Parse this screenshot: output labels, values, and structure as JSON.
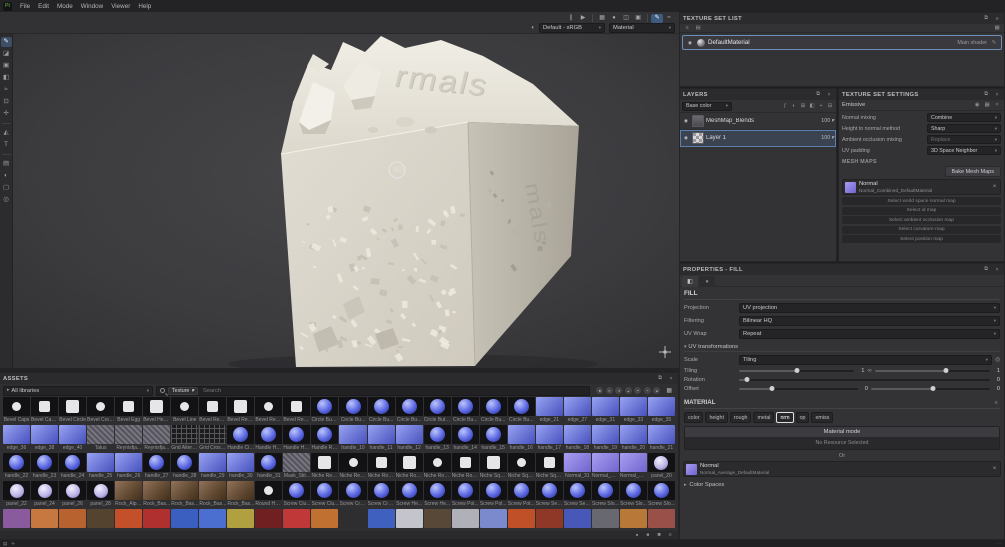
{
  "app": {
    "logo": "Pt"
  },
  "menubar": {
    "items": [
      "File",
      "Edit",
      "Mode",
      "Window",
      "Viewer",
      "Help"
    ]
  },
  "toolbar": {
    "icon_groups": [
      [
        "pause-icon",
        "play-icon"
      ],
      [
        "wireframe-icon",
        "material-ball-icon",
        "split-view-icon",
        "camera-icon"
      ],
      [
        "pencil-icon",
        "lazy-mouse-icon"
      ]
    ],
    "active_icon": "pencil-icon",
    "color_profile": "Default - sRGB",
    "shader": "Material"
  },
  "left_toolbar": {
    "groups": [
      [
        "paint-brush-icon",
        "eraser-icon",
        "projection-icon",
        "polygon-fill-icon",
        "smudge-icon",
        "clone-icon",
        "material-picker-icon"
      ],
      [
        "geometry-mask-icon",
        "text-tool-icon"
      ],
      [
        "shelf-icon",
        "display-settings-icon",
        "camera-settings-icon",
        "environment-icon"
      ]
    ]
  },
  "viewport": {
    "mesh_text": "rmals",
    "mesh_side_text": "mals"
  },
  "texture_set_list": {
    "title": "TEXTURE SET LIST",
    "material_name": "DefaultMaterial",
    "shader_label": "Main shader"
  },
  "layers": {
    "title": "LAYERS",
    "channel_filter": "Base color",
    "toolbar_icons": [
      "add-effect-icon",
      "add-mask-icon",
      "add-folder-icon",
      "add-fill-layer-icon",
      "add-paint-layer-icon",
      "delete-layer-icon"
    ],
    "rows": [
      {
        "name": "MeshMap_Blends",
        "type": "folder",
        "opacity": "100",
        "selected": false
      },
      {
        "name": "Layer 1",
        "type": "fill",
        "opacity": "100",
        "selected": true
      }
    ]
  },
  "texture_set_settings": {
    "title": "TEXTURE SET SETTINGS",
    "channel_label": "Emissive",
    "rows": [
      {
        "label": "Normal mixing",
        "value": "Combine",
        "disabled": false
      },
      {
        "label": "Height to normal method",
        "value": "Sharp",
        "disabled": false
      },
      {
        "label": "Ambient occlusion mixing",
        "value": "Replace",
        "disabled": true
      },
      {
        "label": "UV padding",
        "value": "3D Space Neighbor",
        "disabled": false
      }
    ],
    "mesh_maps_title": "MESH MAPS",
    "bake_button": "Bake Mesh Maps",
    "baked_map": {
      "type": "Normal",
      "resource": "Normal_Combined_DefaultMaterial"
    },
    "empty_maps": [
      "Select world space normal map",
      "Select id map",
      "Select ambient occlusion map",
      "Select curvature map",
      "Select position map"
    ]
  },
  "properties": {
    "title": "PROPERTIES - FILL",
    "fill_section": "FILL",
    "rows": [
      {
        "label": "Projection",
        "value": "UV projection"
      },
      {
        "label": "Filtering",
        "value": "Bilinear HQ"
      },
      {
        "label": "UV Wrap",
        "value": "Repeat"
      }
    ],
    "uv_section": "UV transformations",
    "scale_label": "Scale",
    "scale_mode": "Tiling",
    "tiling_label": "Tiling",
    "tiling_u": "1",
    "tiling_v": "1",
    "rotation_label": "Rotation",
    "rotation_value": "0",
    "offset_label": "Offset",
    "offset_u": "0",
    "offset_v": "0",
    "material_section": "MATERIAL",
    "channels": [
      "color",
      "height",
      "rough",
      "metal",
      "nrm",
      "op",
      "emiss"
    ],
    "active_channel": "nrm",
    "material_mode_title": "Material mode",
    "material_mode_hint": "No Resource Selected",
    "or_label": "Or",
    "normal_map": {
      "type": "Normal",
      "resource": "Normal_Average_DefaultMaterial"
    },
    "color_spaces": "Color Spaces"
  },
  "assets": {
    "title": "ASSETS",
    "libraries": "All libraries",
    "type_filter": "Texture",
    "search_placeholder": "Search",
    "filter_icons": [
      "filter-all-icon",
      "filter-materials-icon",
      "filter-smart-materials-icon",
      "filter-smart-masks-icon",
      "filter-filters-icon",
      "filter-brushes-icon",
      "filter-alphas-icon"
    ],
    "grid": [
      [
        [
          "Bevel Caps",
          "b"
        ],
        [
          "Bevel Cap...",
          "b"
        ],
        [
          "Bevel Circle",
          "b"
        ],
        [
          "Bevel Cros...",
          "b"
        ],
        [
          "Bevel Egg",
          "b"
        ],
        [
          "Bevel Hea...",
          "b"
        ],
        [
          "Bevel Line",
          "b"
        ],
        [
          "Bevel Rect...",
          "b"
        ],
        [
          "Bevel Rect...",
          "b"
        ],
        [
          "Bevel Rect...",
          "b"
        ],
        [
          "Bevel Rect...",
          "b"
        ],
        [
          "Circle Bump",
          "s"
        ],
        [
          "Circle Bu...",
          "s"
        ],
        [
          "Circle Bu...",
          "s"
        ],
        [
          "Circle Bu...",
          "s"
        ],
        [
          "Circle Button",
          "s"
        ],
        [
          "Circle Bu...",
          "s"
        ],
        [
          "Circle Bu...",
          "s"
        ],
        [
          "Circle Bu...",
          "s"
        ],
        [
          "edge_21",
          "q"
        ],
        [
          "edge_27",
          "q"
        ],
        [
          "edge_31",
          "q"
        ],
        [
          "edge_33",
          "q"
        ],
        [
          "edge_35",
          "q"
        ]
      ],
      [
        [
          "edge_36",
          "q"
        ],
        [
          "edge_38",
          "q"
        ],
        [
          "edge_40",
          "q"
        ],
        [
          "Talus",
          "t"
        ],
        [
          "Reynisfja...",
          "t"
        ],
        [
          "Reynisfja...",
          "t"
        ],
        [
          "Grid Altern...",
          "g"
        ],
        [
          "Grid Crossed",
          "g"
        ],
        [
          "Handle Cir...",
          "s"
        ],
        [
          "Handle Ha...",
          "s"
        ],
        [
          "Handle Ha...",
          "s"
        ],
        [
          "Handle Ro...",
          "s"
        ],
        [
          "handle_10",
          "q"
        ],
        [
          "handle_11",
          "q"
        ],
        [
          "handle_12",
          "q"
        ],
        [
          "handle_13",
          "s"
        ],
        [
          "handle_14",
          "s"
        ],
        [
          "handle_15",
          "s"
        ],
        [
          "handle_16",
          "q"
        ],
        [
          "handle_17",
          "q"
        ],
        [
          "handle_18",
          "q"
        ],
        [
          "handle_19",
          "q"
        ],
        [
          "handle_20",
          "q"
        ],
        [
          "handle_21",
          "q"
        ]
      ],
      [
        [
          "handle_22",
          "s"
        ],
        [
          "handle_23",
          "s"
        ],
        [
          "handle_24",
          "s"
        ],
        [
          "handle_25",
          "q"
        ],
        [
          "handle_26",
          "q"
        ],
        [
          "handle_27",
          "s"
        ],
        [
          "handle_28",
          "s"
        ],
        [
          "handle_29",
          "q"
        ],
        [
          "handle_30",
          "q"
        ],
        [
          "handle_31",
          "s"
        ],
        [
          "Mask_Stit...",
          "t"
        ],
        [
          "Niche Rect...",
          "b"
        ],
        [
          "Niche Rect...",
          "b"
        ],
        [
          "Niche Rou...",
          "b"
        ],
        [
          "Niche Rou...",
          "b"
        ],
        [
          "Niche Rou...",
          "b"
        ],
        [
          "Niche Rou...",
          "b"
        ],
        [
          "Niche Squ...",
          "b"
        ],
        [
          "Niche Squ...",
          "b"
        ],
        [
          "Niche Squ...",
          "b"
        ],
        [
          "Normal_31",
          "n"
        ],
        [
          "Normal_Av...",
          "n"
        ],
        [
          "Normal_Co...",
          "n"
        ],
        [
          "panel_20",
          "w"
        ]
      ],
      [
        [
          "panel_22",
          "w"
        ],
        [
          "panel_24",
          "w"
        ],
        [
          "panel_26",
          "w"
        ],
        [
          "panel_28",
          "w"
        ],
        [
          "Rock_Alph...",
          "r"
        ],
        [
          "Rock_Bas...",
          "r"
        ],
        [
          "Rock_Bas...",
          "r"
        ],
        [
          "Rock_Bas...",
          "r"
        ],
        [
          "Rock_Bas...",
          "r"
        ],
        [
          "Round Hol...",
          "b"
        ],
        [
          "Screw Clu...",
          "s"
        ],
        [
          "Screw Clu...",
          "s"
        ],
        [
          "Screw Cro...",
          "s"
        ],
        [
          "Screw Cro...",
          "s"
        ],
        [
          "Screw He...",
          "s"
        ],
        [
          "Screw He...",
          "s"
        ],
        [
          "Screw Pol...",
          "s"
        ],
        [
          "Screw Pol...",
          "s"
        ],
        [
          "Screw Pot...",
          "s"
        ],
        [
          "Screw Sec...",
          "s"
        ],
        [
          "Screw Sec...",
          "s"
        ],
        [
          "Screw Slo...",
          "s"
        ],
        [
          "Screw Slo...",
          "s"
        ],
        [
          "Screw Slo...",
          "s"
        ]
      ],
      [
        [
          "",
          "c:#8a5a9f"
        ],
        [
          "",
          "c:#c77840"
        ],
        [
          "",
          "c:#b8622f"
        ],
        [
          "",
          "c:#54442f"
        ],
        [
          "",
          "c:#c4502a"
        ],
        [
          "",
          "c:#b03030"
        ],
        [
          "",
          "c:#3a5fc0"
        ],
        [
          "",
          "c:#4a6fd0"
        ],
        [
          "",
          "c:#b0a040"
        ],
        [
          "",
          "c:#702020"
        ],
        [
          "",
          "c:#c03838"
        ],
        [
          "",
          "c:#c07030"
        ],
        [
          "",
          "c:#2e2e30"
        ],
        [
          "",
          "c:#4060c0"
        ],
        [
          "",
          "c:#c4c4cc"
        ],
        [
          "",
          "c:#584838"
        ],
        [
          "",
          "c:#b0b0b8"
        ],
        [
          "",
          "c:#7a8acd"
        ],
        [
          "",
          "c:#c05028"
        ],
        [
          "",
          "c:#903828"
        ],
        [
          "",
          "c:#4858b8"
        ],
        [
          "",
          "c:#686870"
        ],
        [
          "",
          "c:#b87838"
        ],
        [
          "",
          "c:#985048"
        ]
      ]
    ]
  }
}
